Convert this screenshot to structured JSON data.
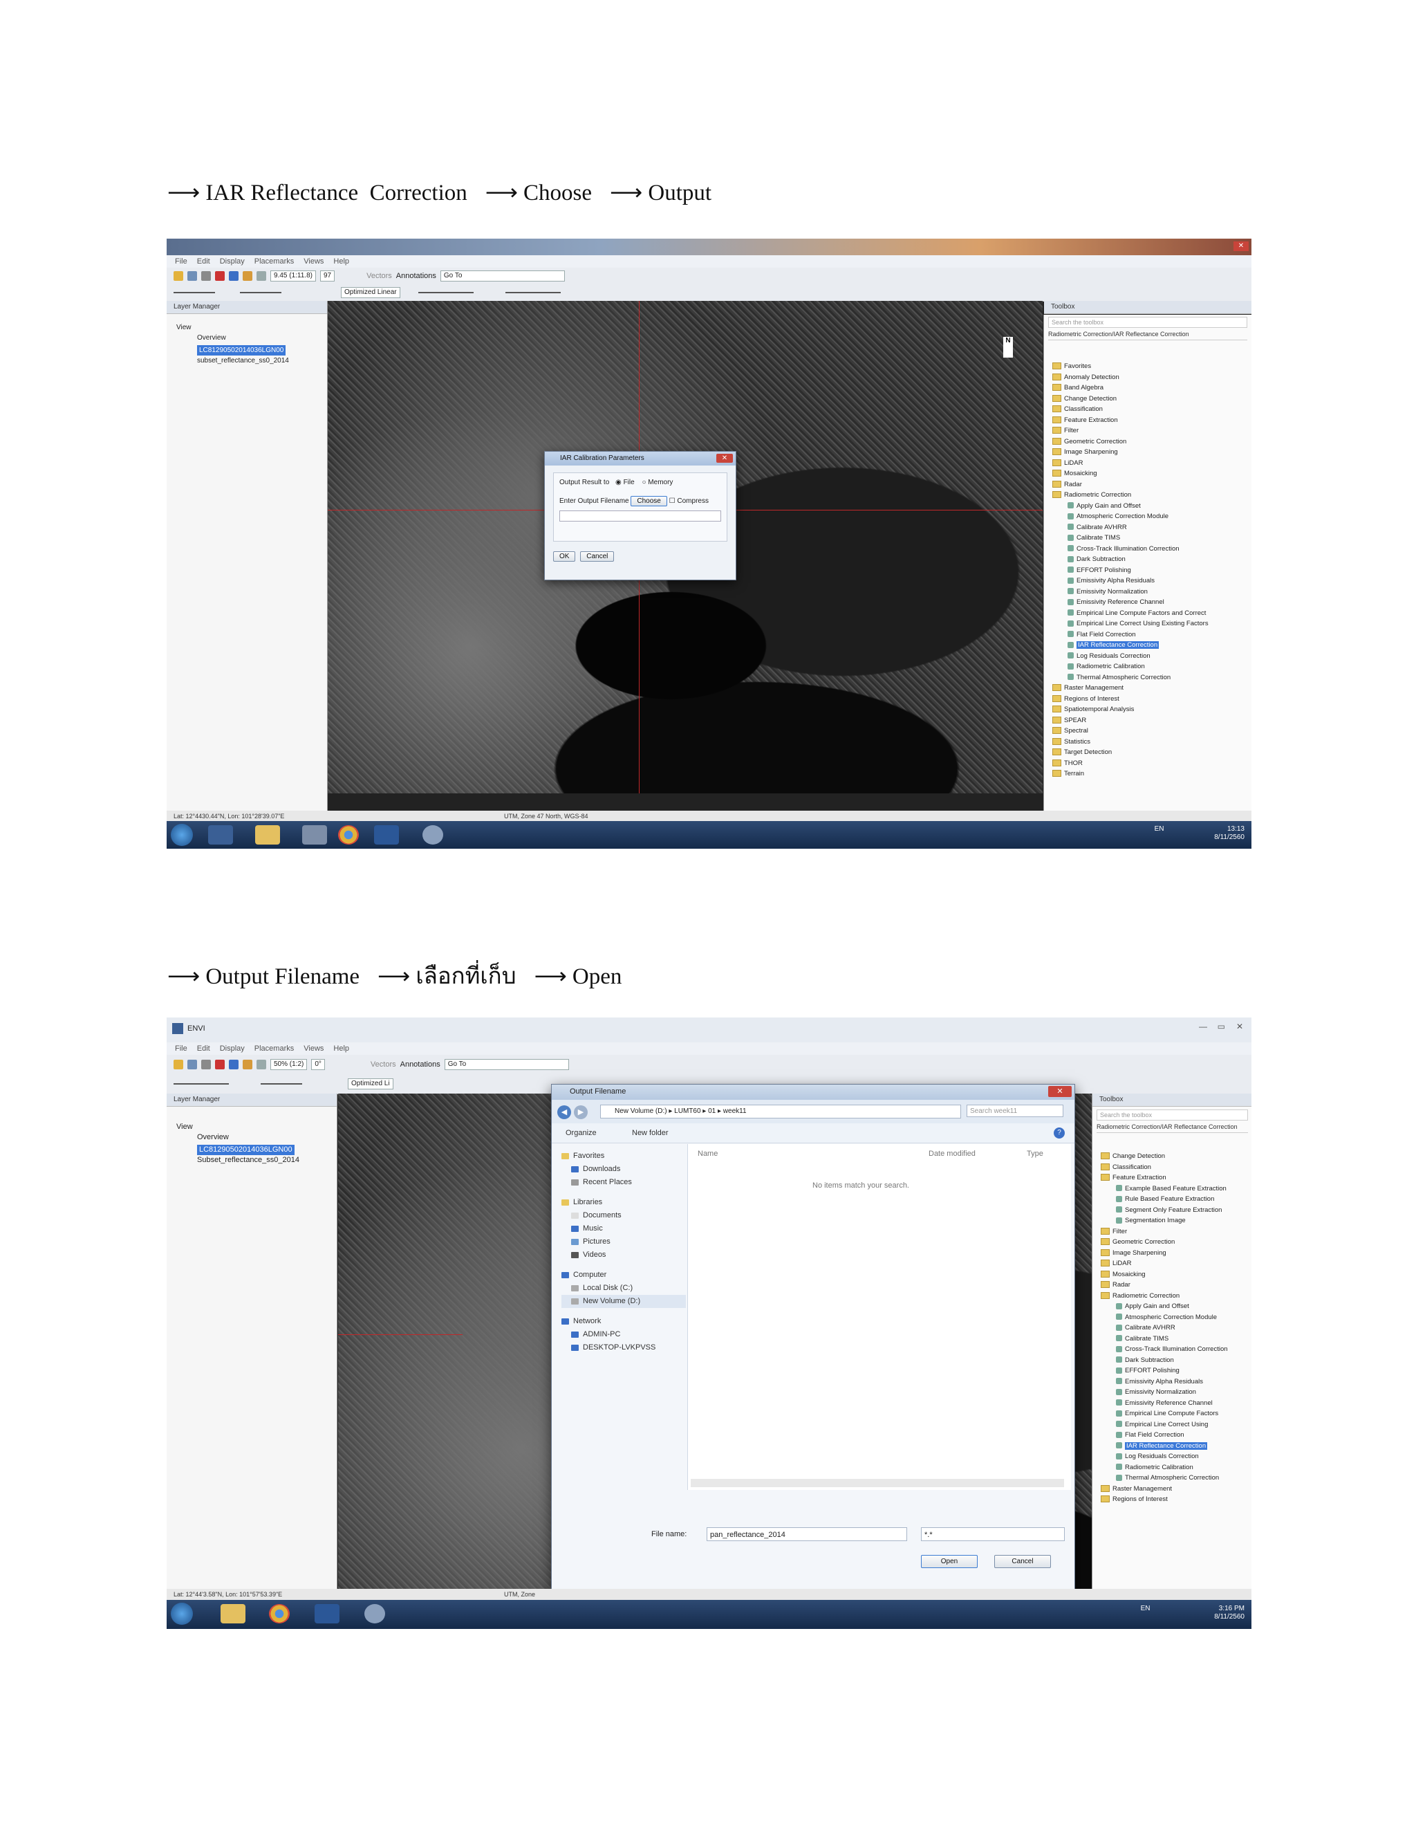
{
  "step1": {
    "arrow": "⟶",
    "items": [
      "IAR Reflectance  Correction",
      "Choose",
      "Output"
    ]
  },
  "step2": {
    "arrow": "⟶",
    "items": [
      "Output Filename",
      "เลือกที่เก็บ",
      "Open"
    ]
  },
  "screenshot1": {
    "menu": [
      "File",
      "Edit",
      "Display",
      "Placemarks",
      "Views",
      "Help"
    ],
    "zoom_value": "9.45 (1:11.8)",
    "rotation_value": "97",
    "stretch_value": "Optimized Linear",
    "vectors_label": "Vectors",
    "annotations_label": "Annotations",
    "goto_label": "Go To",
    "layer_manager_title": "Layer Manager",
    "layers": [
      "View",
      "Overview",
      "LC81290502014036LGN00",
      "subset_reflectance_ss0_2014"
    ],
    "toolbox_title": "Toolbox",
    "toolbox_search": "Search the toolbox",
    "toolbox_path": "Radiometric Correction/IAR Reflectance Correction",
    "toolbox_items": [
      "Favorites",
      "Anomaly Detection",
      "Band Algebra",
      "Change Detection",
      "Classification",
      "Feature Extraction",
      "Filter",
      "Geometric Correction",
      "Image Sharpening",
      "LiDAR",
      "Mosaicking",
      "Radar",
      "Radiometric Correction",
      "Apply Gain and Offset",
      "Atmospheric Correction Module",
      "Calibrate AVHRR",
      "Calibrate TIMS",
      "Cross-Track Illumination Correction",
      "Dark Subtraction",
      "EFFORT Polishing",
      "Emissivity Alpha Residuals",
      "Emissivity Normalization",
      "Emissivity Reference Channel",
      "Empirical Line Compute Factors and Correct",
      "Empirical Line Correct Using Existing Factors",
      "Flat Field Correction",
      "IAR Reflectance Correction",
      "Log Residuals Correction",
      "Radiometric Calibration",
      "Thermal Atmospheric Correction",
      "Raster Management",
      "Regions of Interest",
      "Spatiotemporal Analysis",
      "SPEAR",
      "Spectral",
      "Statistics",
      "Target Detection",
      "THOR",
      "Terrain"
    ],
    "dialog": {
      "title": "IAR Calibration Parameters",
      "output_result_label": "Output Result to",
      "file_option": "File",
      "memory_option": "Memory",
      "filename_label": "Enter Output Filename",
      "choose_button": "Choose",
      "compress_label": "Compress",
      "ok_button": "OK",
      "cancel_button": "Cancel"
    },
    "status_left": "Lat: 12°4430.44\"N, Lon: 101°28'39.07\"E",
    "status_mid": "UTM, Zone 47 North, WGS-84",
    "lang": "EN",
    "time": "13:13",
    "date": "8/11/2560"
  },
  "screenshot2": {
    "app_title": "ENVI",
    "menu": [
      "File",
      "Edit",
      "Display",
      "Placemarks",
      "Views",
      "Help"
    ],
    "zoom_value": "50% (1:2)",
    "rotation_value": "0°",
    "stretch_value": "Optimized Li",
    "vectors_label": "Vectors",
    "annotations_label": "Annotations",
    "goto_label": "Go To",
    "layer_manager_title": "Layer Manager",
    "layers": [
      "View",
      "Overview",
      "LC81290502014036LGN00",
      "Subset_reflectance_ss0_2014"
    ],
    "toolbox_title": "Toolbox",
    "toolbox_search": "Search the toolbox",
    "toolbox_path": "Radiometric Correction/IAR Reflectance Correction",
    "toolbox_items": [
      "Change Detection",
      "Classification",
      "Feature Extraction",
      "Example Based Feature Extraction",
      "Rule Based Feature Extraction",
      "Segment Only Feature Extraction",
      "Segmentation Image",
      "Filter",
      "Geometric Correction",
      "Image Sharpening",
      "LiDAR",
      "Mosaicking",
      "Radar",
      "Radiometric Correction",
      "Apply Gain and Offset",
      "Atmospheric Correction Module",
      "Calibrate AVHRR",
      "Calibrate TIMS",
      "Cross-Track Illumination Correction",
      "Dark Subtraction",
      "EFFORT Polishing",
      "Emissivity Alpha Residuals",
      "Emissivity Normalization",
      "Emissivity Reference Channel",
      "Empirical Line Compute Factors",
      "Empirical Line Correct Using",
      "Flat Field Correction",
      "IAR Reflectance Correction",
      "Log Residuals Correction",
      "Radiometric Calibration",
      "Thermal Atmospheric Correction",
      "Raster Management",
      "Regions of Interest"
    ],
    "file_dialog": {
      "title": "Output Filename",
      "breadcrumb": [
        "New Volume (D:)",
        "LUMT60",
        "01",
        "week11"
      ],
      "search_placeholder": "Search week11",
      "organize": "Organize",
      "new_folder": "New folder",
      "col_name": "Name",
      "col_date": "Date modified",
      "col_type": "Type",
      "empty_message": "No items match your search.",
      "favorites": [
        "Favorites",
        "Downloads",
        "Recent Places"
      ],
      "libraries": [
        "Libraries",
        "Documents",
        "Music",
        "Pictures",
        "Videos"
      ],
      "computer": [
        "Computer",
        "Local Disk (C:)",
        "New Volume (D:)"
      ],
      "network": [
        "Network",
        "ADMIN-PC",
        "DESKTOP-LVKPVSS"
      ],
      "filename_label": "File name:",
      "filename_value": "pan_reflectance_2014",
      "filter_value": "*.*",
      "open_button": "Open",
      "cancel_button": "Cancel"
    },
    "status_left": "Lat: 12°44'3.58\"N, Lon: 101°57'53.39\"E",
    "status_mid": "UTM, Zone",
    "lang": "EN",
    "time": "3:16 PM",
    "date": "8/11/2560"
  }
}
